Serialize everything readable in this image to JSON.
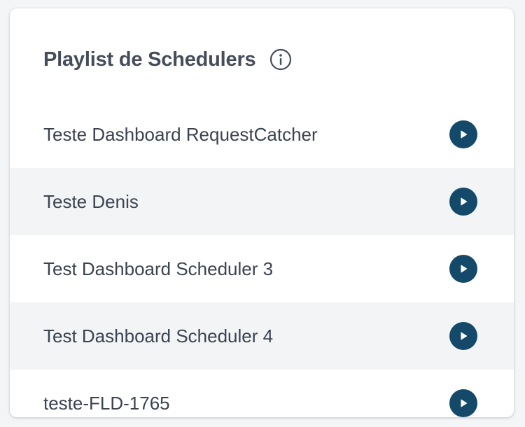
{
  "panel": {
    "title": "Playlist de Schedulers",
    "info_icon": "info-circle-icon"
  },
  "colors": {
    "title": "#454c5a",
    "text": "#3b4250",
    "play_button": "#14496a",
    "alt_row": "#f2f4f6"
  },
  "schedulers": [
    {
      "label": "Teste Dashboard RequestCatcher",
      "icon": "play-icon"
    },
    {
      "label": "Teste Denis",
      "icon": "play-icon"
    },
    {
      "label": "Test Dashboard Scheduler 3",
      "icon": "play-icon"
    },
    {
      "label": "Test Dashboard Scheduler 4",
      "icon": "play-icon"
    },
    {
      "label": "teste-FLD-1765",
      "icon": "play-icon"
    }
  ]
}
